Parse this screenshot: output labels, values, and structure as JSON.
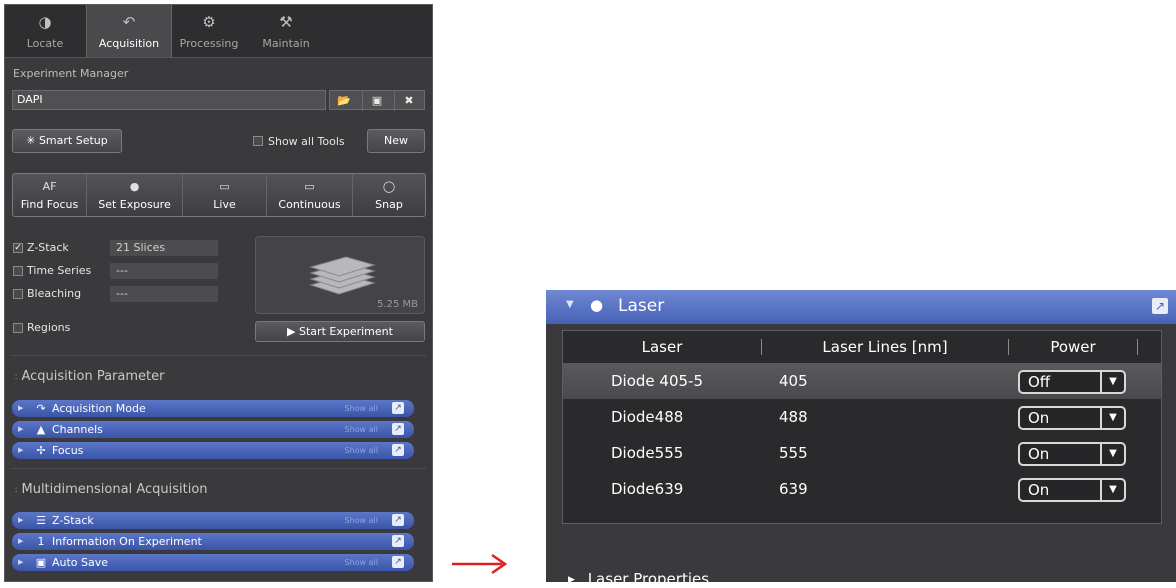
{
  "tabs": [
    {
      "label": "Locate",
      "icon": "locate-icon"
    },
    {
      "label": "Acquisition",
      "icon": "acquisition-icon"
    },
    {
      "label": "Processing",
      "icon": "processing-icon"
    },
    {
      "label": "Maintain",
      "icon": "maintain-icon"
    }
  ],
  "experiment": {
    "label": "Experiment Manager",
    "name": "DAPI",
    "smart_setup": "Smart Setup",
    "show_all_tools": "Show all Tools",
    "new_button": "New"
  },
  "tools": [
    {
      "icon_text": "AF",
      "label": "Find Focus"
    },
    {
      "icon": "camera-icon",
      "label": "Set Exposure"
    },
    {
      "icon": "live-icon",
      "label": "Live"
    },
    {
      "icon": "continuous-icon",
      "label": "Continuous"
    },
    {
      "icon": "snap-icon",
      "label": "Snap"
    }
  ],
  "options": [
    {
      "label": "Z-Stack",
      "value": "21 Slices",
      "checked": true
    },
    {
      "label": "Time Series",
      "value": "---",
      "checked": false
    },
    {
      "label": "Bleaching",
      "value": "---",
      "checked": false
    },
    {
      "label": "Regions",
      "checked": false
    }
  ],
  "preview_size": "5.25 MB",
  "start_experiment": "Start Experiment",
  "sections": [
    {
      "title": "Acquisition Parameter",
      "items": [
        {
          "label": "Acquisition Mode",
          "icon": "acquisition-mode-icon",
          "show_all": "Show all"
        },
        {
          "label": "Channels",
          "icon": "channels-icon",
          "show_all": "Show all"
        },
        {
          "label": "Focus",
          "icon": "focus-icon",
          "show_all": "Show all"
        }
      ]
    },
    {
      "title": "Multidimensional Acquisition",
      "items": [
        {
          "label": "Z-Stack",
          "icon": "zstack-icon",
          "show_all": "Show all"
        },
        {
          "label": "Information On Experiment",
          "icon": "info-icon"
        },
        {
          "label": "Auto Save",
          "icon": "save-icon",
          "show_all": "Show all"
        }
      ]
    }
  ],
  "laser_panel": {
    "title": "Laser",
    "columns": [
      "Laser",
      "Laser Lines [nm]",
      "Power"
    ],
    "rows": [
      {
        "laser": "Diode 405-5",
        "line": "405",
        "power": "Off",
        "selected": true
      },
      {
        "laser": "Diode488",
        "line": "488",
        "power": "On",
        "selected": false
      },
      {
        "laser": "Diode555",
        "line": "555",
        "power": "On",
        "selected": false
      },
      {
        "laser": "Diode639",
        "line": "639",
        "power": "On",
        "selected": false
      }
    ],
    "properties": "Laser Properties"
  },
  "colors": {
    "panel_bg": "#3a3a3c",
    "accent_blue": "#4761b5",
    "arrow_red": "#e02020"
  }
}
